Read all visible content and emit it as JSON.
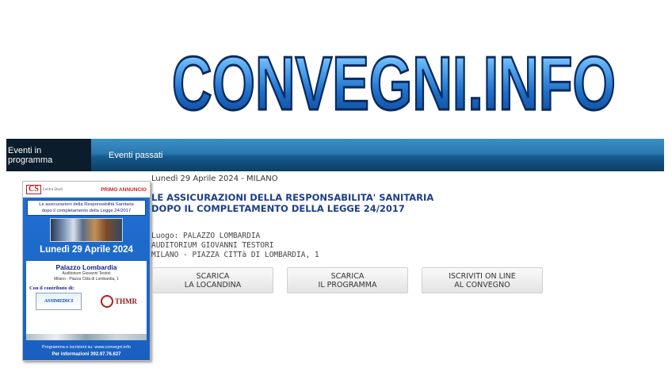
{
  "logo": {
    "text": "CONVEGNI.INFO"
  },
  "nav": {
    "items": [
      {
        "label": "Eventi in programma",
        "active": true
      },
      {
        "label": "Eventi passati",
        "active": false
      }
    ]
  },
  "poster": {
    "brand": "CS",
    "brand_sub": "Centro Studi",
    "badge": "PRIMO ANNUNCIO",
    "title_line1": "Le assicurazioni della Responsabilità Sanitaria",
    "title_line2": "dopo il completamento della Legge 24/2017",
    "date": "Lunedì 29 Aprile 2024",
    "place": "Palazzo Lombardia",
    "auditorium": "Auditorium Giovanni Testori",
    "address": "Milano - Piazza Città di Lombardia, 1",
    "contrib": "Con il contributo di:",
    "sponsor1": "ASSIMEDICI",
    "sponsor2": "THMR",
    "footer1": "Programma e iscrizioni su: www.convegni.info",
    "footer2": "Per informazioni 392.97.76.627"
  },
  "event": {
    "date_line": "Lunedì 29 Aprile 2024 - MILANO",
    "title_line1": "LE ASSICURAZIONI DELLA RESPONSABILITA' SANITARIA",
    "title_line2": "DOPO IL COMPLETAMENTO DELLA LEGGE 24/2017",
    "location_line1": "Luogo: PALAZZO LOMBARDIA",
    "location_line2": "AUDITORIUM GIOVANNI TESTORI",
    "location_line3": "MILANO - PIAZZA CITTà DI LOMBARDIA, 1"
  },
  "buttons": [
    {
      "line1": "SCARICA",
      "line2": "LA LOCANDINA"
    },
    {
      "line1": "SCARICA",
      "line2": "IL PROGRAMMA"
    },
    {
      "line1": "ISCRIVITI ON LINE",
      "line2": "AL CONVEGNO"
    }
  ],
  "colors": {
    "nav_blue": "#2a78b0",
    "nav_active": "#0b1c2c",
    "title_blue": "#1c3f8a",
    "logo_blue": "#1565c0"
  }
}
